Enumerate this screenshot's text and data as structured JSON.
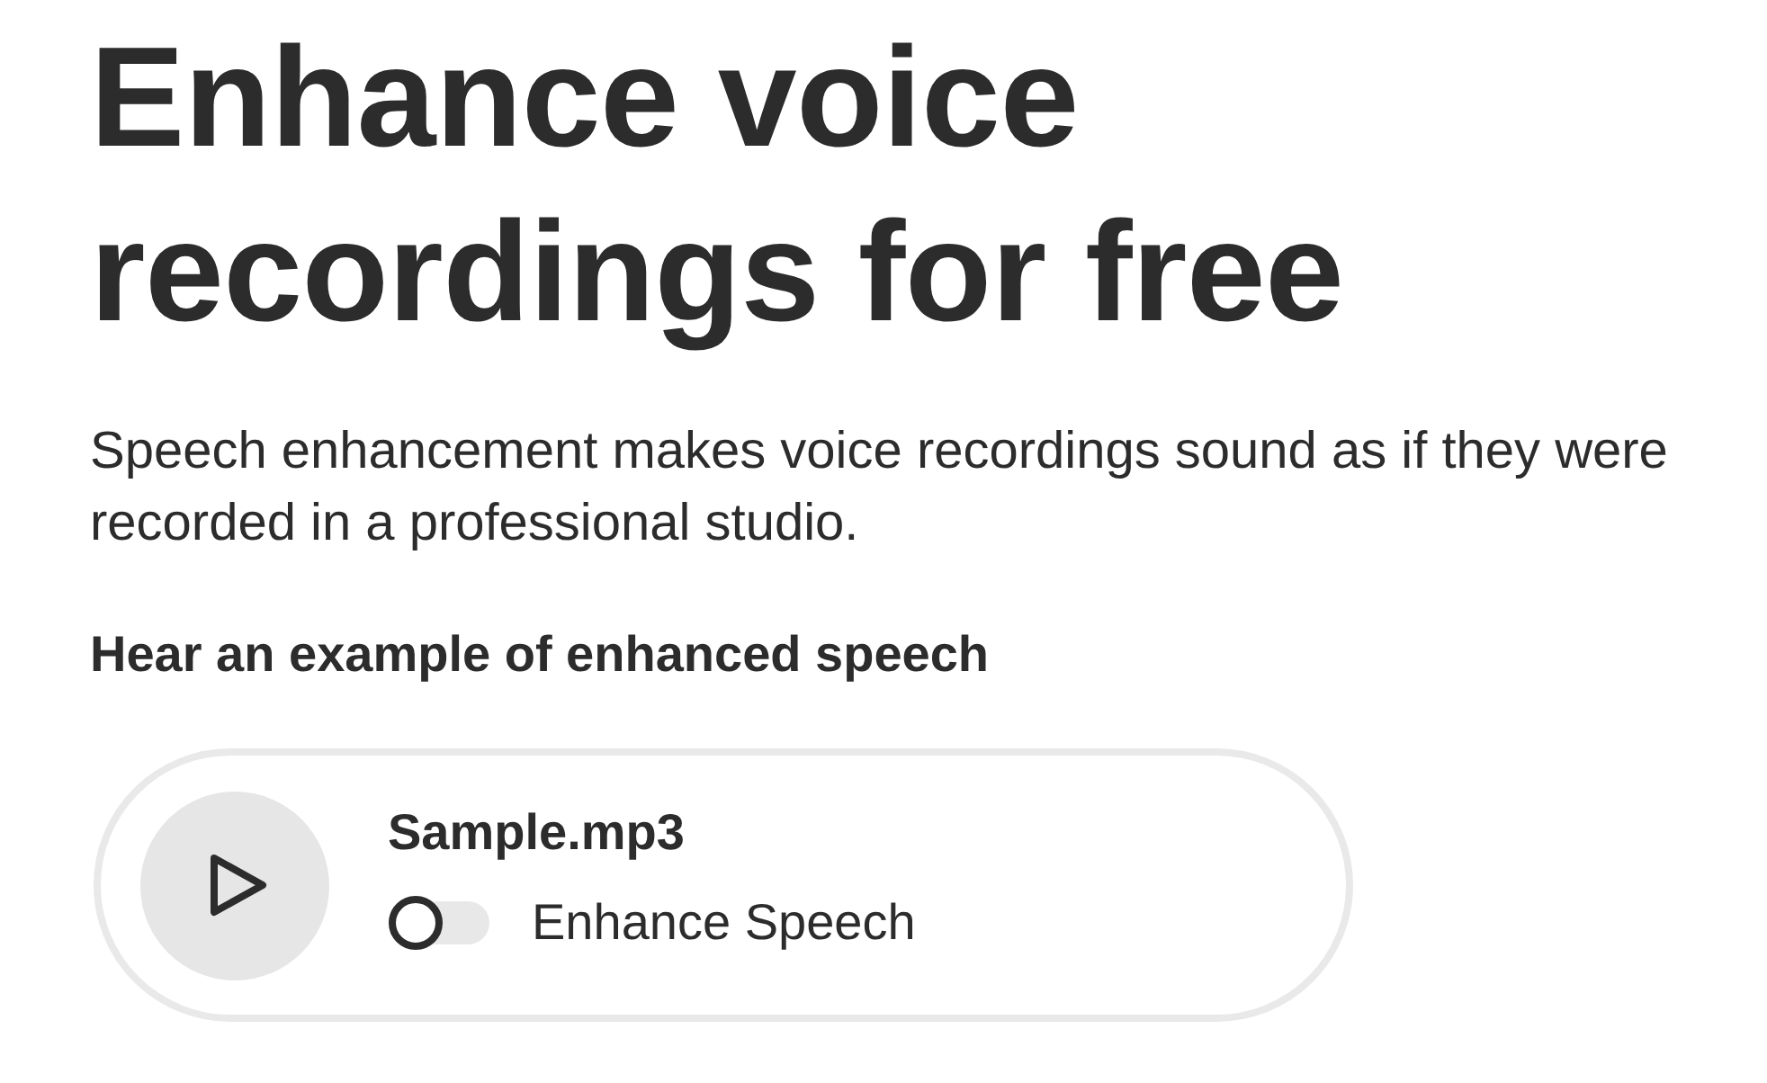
{
  "heading": "Enhance voice recordings for free",
  "description": "Speech enhancement makes voice recordings sound as if they were recorded in a professional studio.",
  "example_heading": "Hear an example of enhanced speech",
  "player": {
    "file_name": "Sample.mp3",
    "toggle": {
      "label": "Enhance Speech",
      "on": false
    }
  }
}
